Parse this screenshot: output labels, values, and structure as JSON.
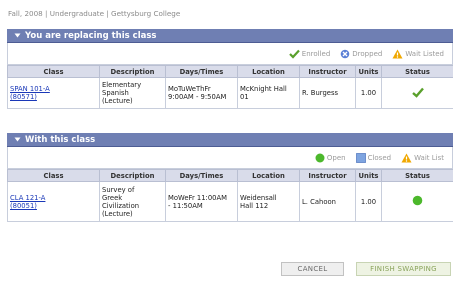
{
  "term": "Fall, 2008 | Undergraduate | Gettysburg College",
  "replacing": {
    "title": "You are replacing this class",
    "legend": {
      "enrolled": "Enrolled",
      "dropped": "Dropped",
      "wait_listed": "Wait Listed"
    },
    "columns": [
      "Class",
      "Description",
      "Days/Times",
      "Location",
      "Instructor",
      "Units",
      "Status"
    ],
    "row": {
      "class_code": "SPAN 101-A",
      "class_number": "(80571)",
      "desc": [
        "Elementary",
        "Spanish",
        "(Lecture)"
      ],
      "days": "MoTuWeThFr",
      "times": "9:00AM - 9:50AM",
      "location": [
        "McKnight Hall",
        "01"
      ],
      "instructor": "R. Burgess",
      "units": "1.00",
      "status_icon": "check-icon"
    }
  },
  "with": {
    "title": "With this class",
    "legend": {
      "open": "Open",
      "closed": "Closed",
      "wait_list": "Wait List"
    },
    "columns": [
      "Class",
      "Description",
      "Days/Times",
      "Location",
      "Instructor",
      "Units",
      "Status"
    ],
    "row": {
      "class_code": "CLA 121-A",
      "class_number": "(80051)",
      "desc": [
        "Survey of",
        "Greek",
        "Civilization",
        "(Lecture)"
      ],
      "days_times": [
        "MoWeFr 11:00AM",
        "- 11:50AM"
      ],
      "location": [
        "Weidensall",
        "Hall 112"
      ],
      "instructor": "L. Cahoon",
      "units": "1.00",
      "status_icon": "open-circle-icon"
    }
  },
  "buttons": {
    "cancel": "CANCEL",
    "finish": "FINISH SWAPPING"
  },
  "colors": {
    "header": "#6f7fb3",
    "enrolled": "#5aa02c",
    "dropped": "#5b7fd6",
    "wait": "#f0a800",
    "open": "#4cb82c",
    "closed": "#7ea4e0",
    "link": "#1a38b8"
  }
}
